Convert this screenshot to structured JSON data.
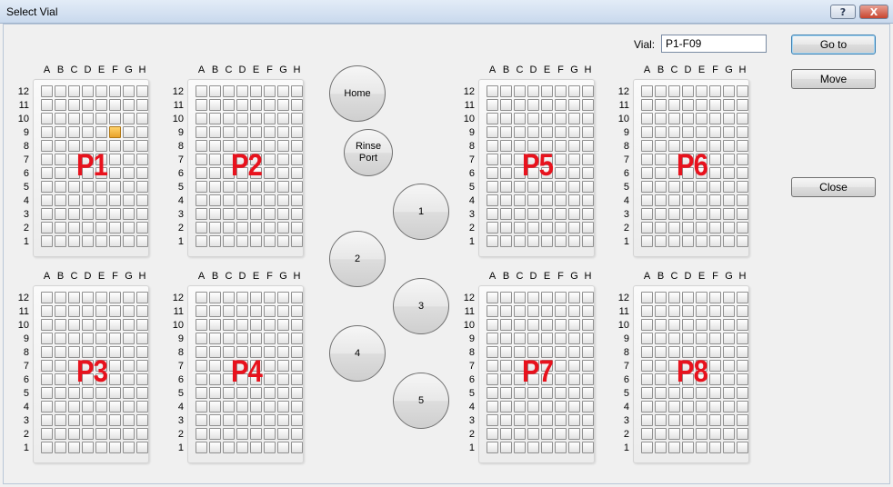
{
  "window": {
    "title": "Select Vial",
    "help_label": "?",
    "close_label": "X"
  },
  "vial": {
    "label": "Vial:",
    "value": "P1-F09"
  },
  "buttons": {
    "goto": "Go to",
    "move": "Move",
    "close": "Close"
  },
  "positions": {
    "home": "Home",
    "rinse_port": "Rinse Port",
    "p1": "1",
    "p2": "2",
    "p3": "3",
    "p4": "4",
    "p5": "5"
  },
  "columns": [
    "A",
    "B",
    "C",
    "D",
    "E",
    "F",
    "G",
    "H"
  ],
  "rows": [
    "12",
    "11",
    "10",
    "9",
    "8",
    "7",
    "6",
    "5",
    "4",
    "3",
    "2",
    "1"
  ],
  "plates": [
    {
      "name": "P1",
      "selected": {
        "column": "F",
        "row": "9"
      }
    },
    {
      "name": "P2"
    },
    {
      "name": "P3"
    },
    {
      "name": "P4"
    },
    {
      "name": "P5"
    },
    {
      "name": "P6"
    },
    {
      "name": "P7"
    },
    {
      "name": "P8"
    }
  ],
  "colors": {
    "plate_label": "#e8121d",
    "selected_vial": "#f0b040"
  }
}
